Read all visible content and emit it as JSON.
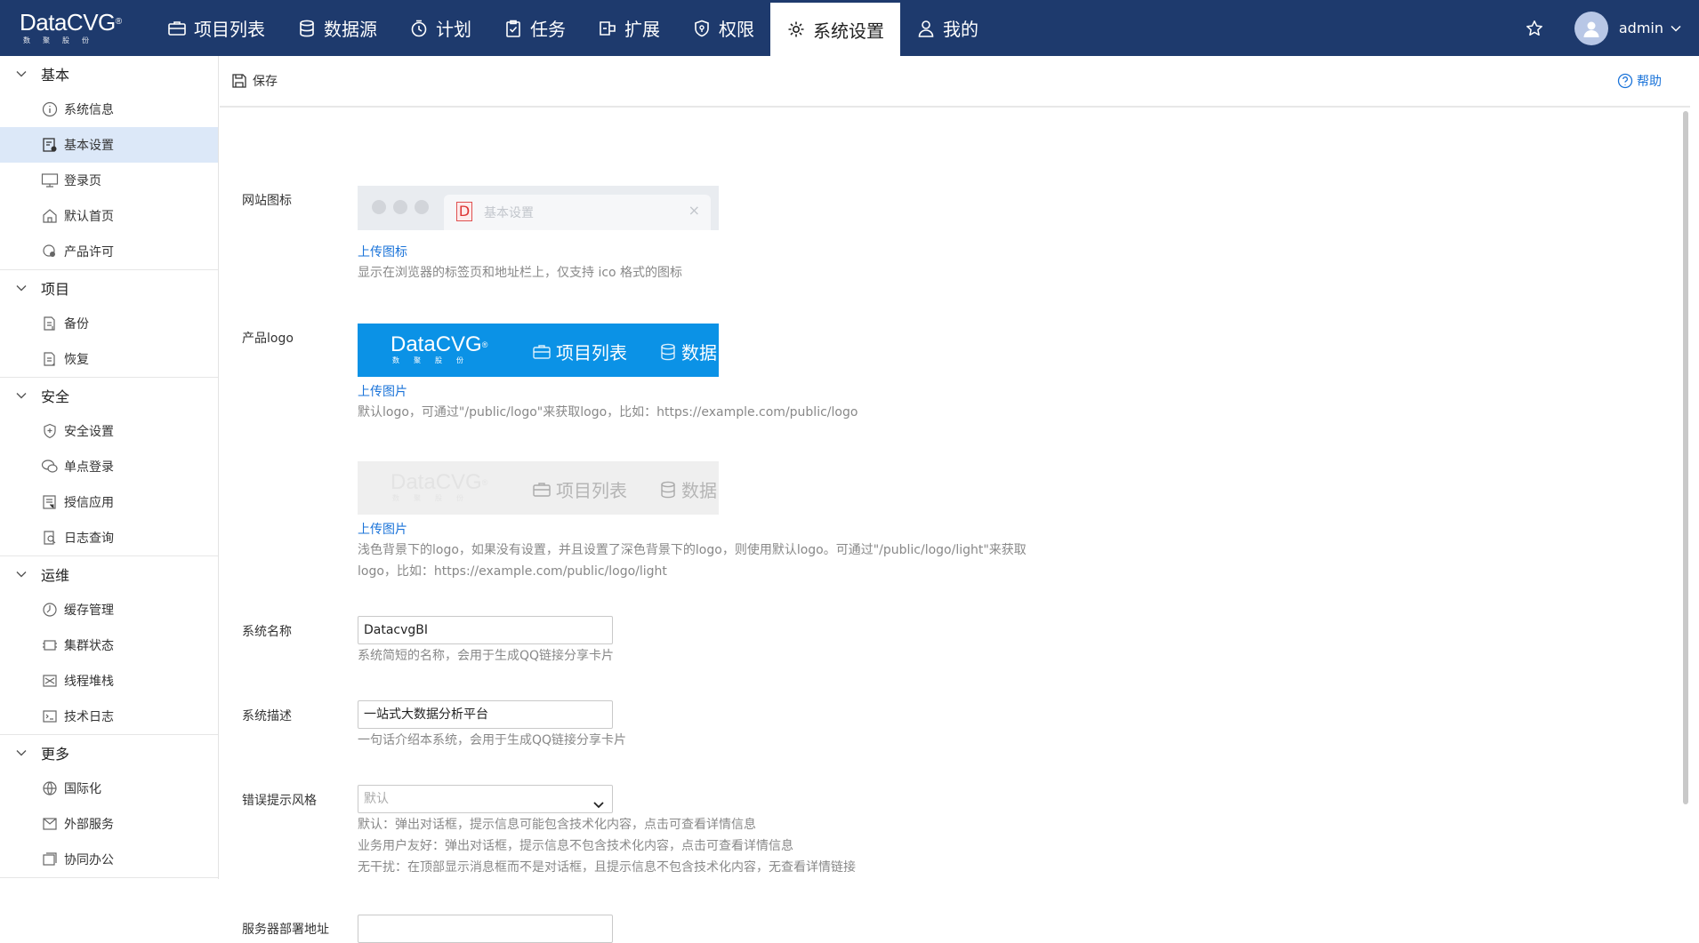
{
  "brand": {
    "name": "DataCVG",
    "sub": "数聚股份",
    "reg": "®"
  },
  "nav": [
    {
      "label": "项目列表",
      "icon": "briefcase-icon"
    },
    {
      "label": "数据源",
      "icon": "database-icon"
    },
    {
      "label": "计划",
      "icon": "timer-icon"
    },
    {
      "label": "任务",
      "icon": "task-icon"
    },
    {
      "label": "扩展",
      "icon": "extension-icon"
    },
    {
      "label": "权限",
      "icon": "shield-icon"
    },
    {
      "label": "系统设置",
      "icon": "gear-icon",
      "active": true
    },
    {
      "label": "我的",
      "icon": "user-icon"
    }
  ],
  "user": {
    "name": "admin"
  },
  "sidebar": [
    {
      "title": "基本",
      "items": [
        {
          "label": "系统信息",
          "icon": "info-icon"
        },
        {
          "label": "基本设置",
          "icon": "settings-doc-icon",
          "active": true
        },
        {
          "label": "登录页",
          "icon": "monitor-icon"
        },
        {
          "label": "默认首页",
          "icon": "home-icon"
        },
        {
          "label": "产品许可",
          "icon": "license-icon"
        }
      ]
    },
    {
      "title": "项目",
      "items": [
        {
          "label": "备份",
          "icon": "backup-icon"
        },
        {
          "label": "恢复",
          "icon": "restore-icon"
        }
      ]
    },
    {
      "title": "安全",
      "items": [
        {
          "label": "安全设置",
          "icon": "shield-plus-icon"
        },
        {
          "label": "单点登录",
          "icon": "chat-icon"
        },
        {
          "label": "授信应用",
          "icon": "app-icon"
        },
        {
          "label": "日志查询",
          "icon": "log-search-icon"
        }
      ]
    },
    {
      "title": "运维",
      "items": [
        {
          "label": "缓存管理",
          "icon": "cache-icon"
        },
        {
          "label": "集群状态",
          "icon": "cluster-icon"
        },
        {
          "label": "线程堆栈",
          "icon": "thread-icon"
        },
        {
          "label": "技术日志",
          "icon": "terminal-icon"
        }
      ]
    },
    {
      "title": "更多",
      "items": [
        {
          "label": "国际化",
          "icon": "globe-icon"
        },
        {
          "label": "外部服务",
          "icon": "external-icon"
        },
        {
          "label": "协同办公",
          "icon": "collab-icon"
        }
      ]
    }
  ],
  "toolbar": {
    "save": "保存",
    "help": "帮助"
  },
  "form": {
    "favicon": {
      "label": "网站图标",
      "tab_letter": "D",
      "tab_title": "基本设置",
      "tab_close": "×",
      "upload": "上传图标",
      "hint": "显示在浏览器的标签页和地址栏上，仅支持 ico 格式的图标"
    },
    "logo": {
      "label": "产品logo",
      "preview_nav1": "项目列表",
      "preview_nav2": "数据",
      "upload": "上传图片",
      "hint": "默认logo，可通过\"/public/logo\"来获取logo，比如：https://example.com/public/logo"
    },
    "logo_light": {
      "upload": "上传图片",
      "hint_line1": "浅色背景下的logo，如果没有设置，并且设置了深色背景下的logo，则使用默认logo。可通过\"/public/logo/light\"来获取",
      "hint_line2": "logo，比如：https://example.com/public/logo/light"
    },
    "system_name": {
      "label": "系统名称",
      "value": "DatacvgBI",
      "hint": "系统简短的名称，会用于生成QQ链接分享卡片"
    },
    "system_desc": {
      "label": "系统描述",
      "value": "一站式大数据分析平台",
      "hint": "一句话介绍本系统，会用于生成QQ链接分享卡片"
    },
    "error_style": {
      "label": "错误提示风格",
      "placeholder": "默认",
      "hint1": "默认：弹出对话框，提示信息可能包含技术化内容，点击可查看详情信息",
      "hint2": "业务用户友好：弹出对话框，提示信息不包含技术化内容，点击可查看详情信息",
      "hint3": "无干扰：在顶部显示消息框而不是对话框，且提示信息不包含技术化内容，无查看详情链接"
    },
    "server_addr": {
      "label": "服务器部署地址"
    }
  }
}
